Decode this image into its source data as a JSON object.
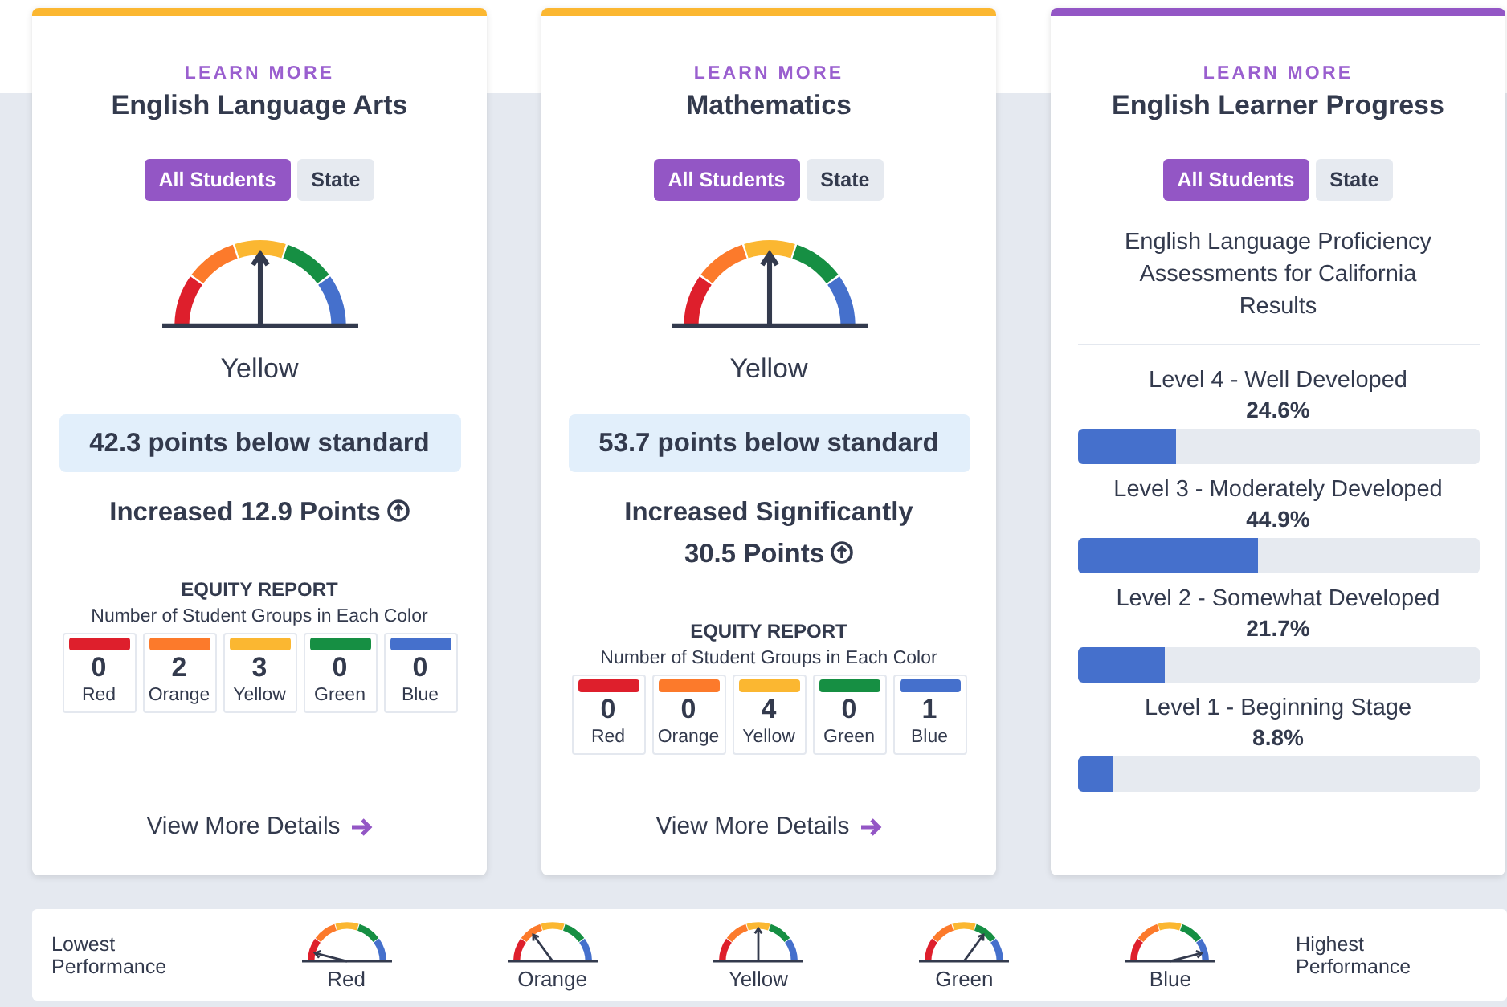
{
  "cards": [
    {
      "kind": "gauge",
      "color": "#fbb731",
      "link": "LEARN MORE",
      "title": "English Language Arts",
      "tabs": [
        {
          "label": "All Students",
          "selected": true
        },
        {
          "label": "State",
          "selected": false
        }
      ],
      "gauge": {
        "kind": "center",
        "rating": "Yellow"
      },
      "status": "42.3 points below standard",
      "change": "Increased 12.9 Points",
      "equity": {
        "title": "EQUITY REPORT",
        "subtitle": "Number of Student Groups in Each Color",
        "groups": [
          {
            "color": "#de1f2c",
            "count": "0",
            "label": "Red"
          },
          {
            "color": "#fc7a2b",
            "count": "2",
            "label": "Orange"
          },
          {
            "color": "#fbb731",
            "count": "3",
            "label": "Yellow"
          },
          {
            "color": "#168f43",
            "count": "0",
            "label": "Green"
          },
          {
            "color": "#4570cc",
            "count": "0",
            "label": "Blue"
          }
        ]
      },
      "details_link": "View More Details"
    },
    {
      "kind": "gauge",
      "color": "#fbb731",
      "link": "LEARN MORE",
      "title": "Mathematics",
      "tabs": [
        {
          "label": "All Students",
          "selected": true
        },
        {
          "label": "State",
          "selected": false
        }
      ],
      "gauge": {
        "kind": "center",
        "rating": "Yellow"
      },
      "status": "53.7 points below standard",
      "change": "Increased Significantly 30.5 Points",
      "equity": {
        "title": "EQUITY REPORT",
        "subtitle": "Number of Student Groups in Each Color",
        "groups": [
          {
            "color": "#de1f2c",
            "count": "0",
            "label": "Red"
          },
          {
            "color": "#fc7a2b",
            "count": "0",
            "label": "Orange"
          },
          {
            "color": "#fbb731",
            "count": "4",
            "label": "Yellow"
          },
          {
            "color": "#168f43",
            "count": "0",
            "label": "Green"
          },
          {
            "color": "#4570cc",
            "count": "1",
            "label": "Blue"
          }
        ]
      },
      "details_link": "View More Details"
    },
    {
      "kind": "levels",
      "color": "#9356c5",
      "link": "LEARN MORE",
      "title": "English Learner Progress",
      "tabs": [
        {
          "label": "All Students",
          "selected": true
        },
        {
          "label": "State",
          "selected": false
        }
      ],
      "description": "English Language Proficiency Assessments for California Results",
      "levels": [
        {
          "label": "Level 4 - Well Developed",
          "percent": "24.6%",
          "level": 0.246
        },
        {
          "label": "Level 3 - Moderately Developed",
          "percent": "44.9%",
          "level": 0.449
        },
        {
          "label": "Level 2 - Somewhat Developed",
          "percent": "21.7%",
          "level": 0.217
        },
        {
          "label": "Level 1 - Beginning Stage",
          "percent": "8.8%",
          "level": 0.088
        }
      ]
    }
  ],
  "legend": {
    "low": "Lowest Performance",
    "high": "Highest Performance",
    "items": [
      {
        "label": "Red",
        "kind": "farleft"
      },
      {
        "label": "Orange",
        "kind": "left"
      },
      {
        "label": "Yellow",
        "kind": "center"
      },
      {
        "label": "Green",
        "kind": "right"
      },
      {
        "label": "Blue",
        "kind": "farright"
      }
    ]
  }
}
